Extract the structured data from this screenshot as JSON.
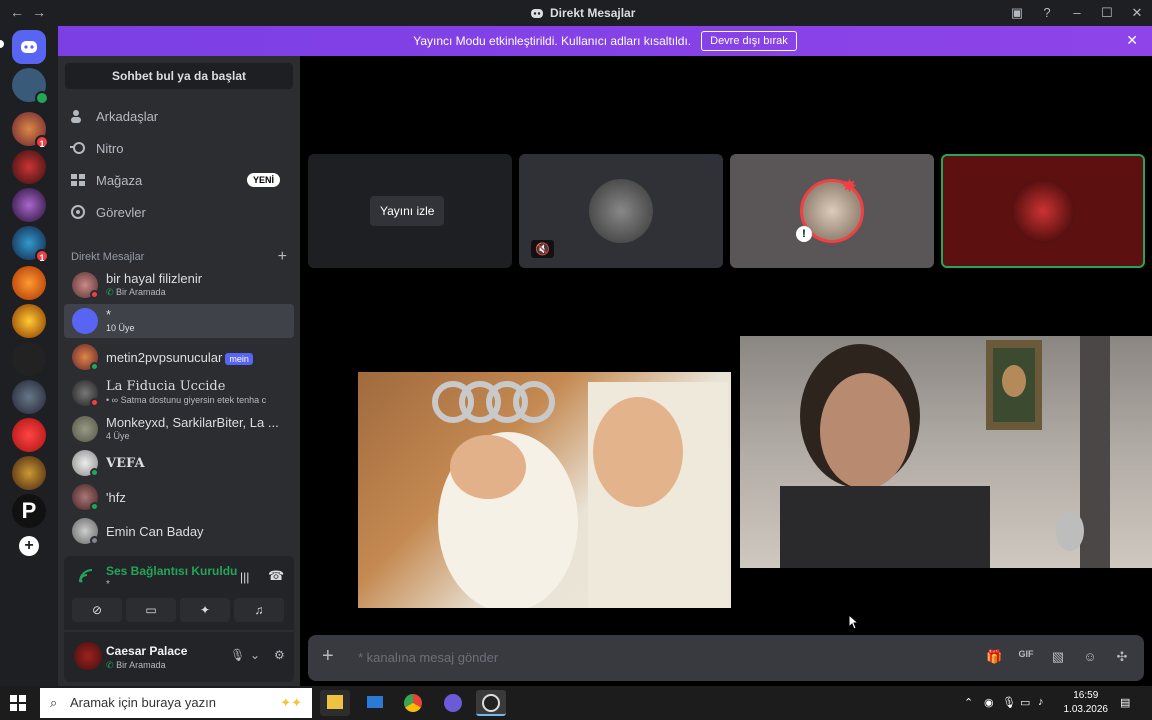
{
  "window": {
    "title": "Direkt Mesajlar"
  },
  "banner": {
    "text": "Yayıncı Modu etkinleştirildi. Kullanıcı adları kısaltıldı.",
    "button": "Devre dışı bırak"
  },
  "sidebar": {
    "search": "Sohbet bul ya da başlat",
    "nav": [
      {
        "label": "Arkadaşlar",
        "icon": "friends-icon"
      },
      {
        "label": "Nitro",
        "icon": "nitro-icon"
      },
      {
        "label": "Mağaza",
        "icon": "shop-icon",
        "badge": "YENİ"
      },
      {
        "label": "Görevler",
        "icon": "quests-icon"
      }
    ],
    "dm_header": "Direkt Mesajlar",
    "dms": [
      {
        "name": "bir hayal filizlenir",
        "sub": "Bir Aramada"
      },
      {
        "name": "*",
        "sub": "10 Üye"
      },
      {
        "name": "metin2pvpsunucular",
        "tag": "mein"
      },
      {
        "name": "La Fiducia Uccide",
        "sub": "• ∞ Satma dostunu giyersin etek tenha c"
      },
      {
        "name": "Monkeyxd, SarkilarBiter, La ...",
        "sub": "4 Üye"
      },
      {
        "name": "VEFA"
      },
      {
        "name": "'hfz"
      },
      {
        "name": "Emin Can Baday"
      }
    ],
    "voice": {
      "title": "Ses Bağlantısı Kuruldu",
      "channel": "*"
    },
    "user": {
      "name": "Caesar Palace",
      "status": "Bir Aramada"
    }
  },
  "stage": {
    "watch_label": "Yayını izle"
  },
  "chat": {
    "placeholder": "* kanalına mesaj gönder"
  },
  "taskbar": {
    "search": "Aramak için buraya yazın",
    "time": "16:59",
    "date": "1.03.2026"
  },
  "colors": {
    "accent": "#5865f2",
    "banner": "#8e44e8",
    "online": "#23a55a",
    "dnd": "#f23f43"
  }
}
